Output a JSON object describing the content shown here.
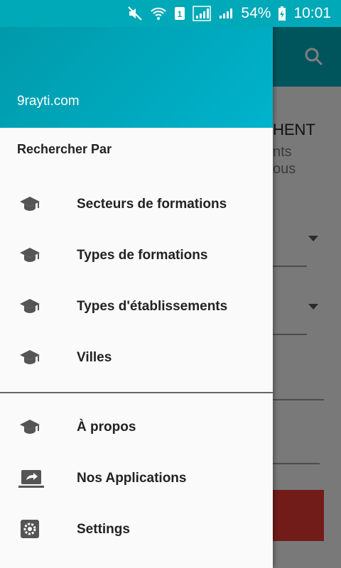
{
  "status_bar": {
    "battery": "54%",
    "time": "10:01",
    "sim": "1"
  },
  "background": {
    "title_fragment": "HENT",
    "sub_fragment_1": "nts",
    "sub_fragment_2": "ous"
  },
  "drawer": {
    "header_site": "9rayti.com",
    "section_title": "Rechercher Par",
    "items": [
      {
        "label": "Secteurs de formations",
        "icon": "graduation-cap-icon"
      },
      {
        "label": "Types de formations",
        "icon": "graduation-cap-icon"
      },
      {
        "label": "Types d'établissements",
        "icon": "graduation-cap-icon"
      },
      {
        "label": "Villes",
        "icon": "graduation-cap-icon"
      }
    ],
    "secondary_items": [
      {
        "label": "À propos",
        "icon": "graduation-cap-icon"
      },
      {
        "label": "Nos Applications",
        "icon": "share-laptop-icon"
      },
      {
        "label": "Settings",
        "icon": "gear-icon"
      }
    ]
  },
  "colors": {
    "primary": "#00a9b8",
    "accent": "#e53935"
  }
}
